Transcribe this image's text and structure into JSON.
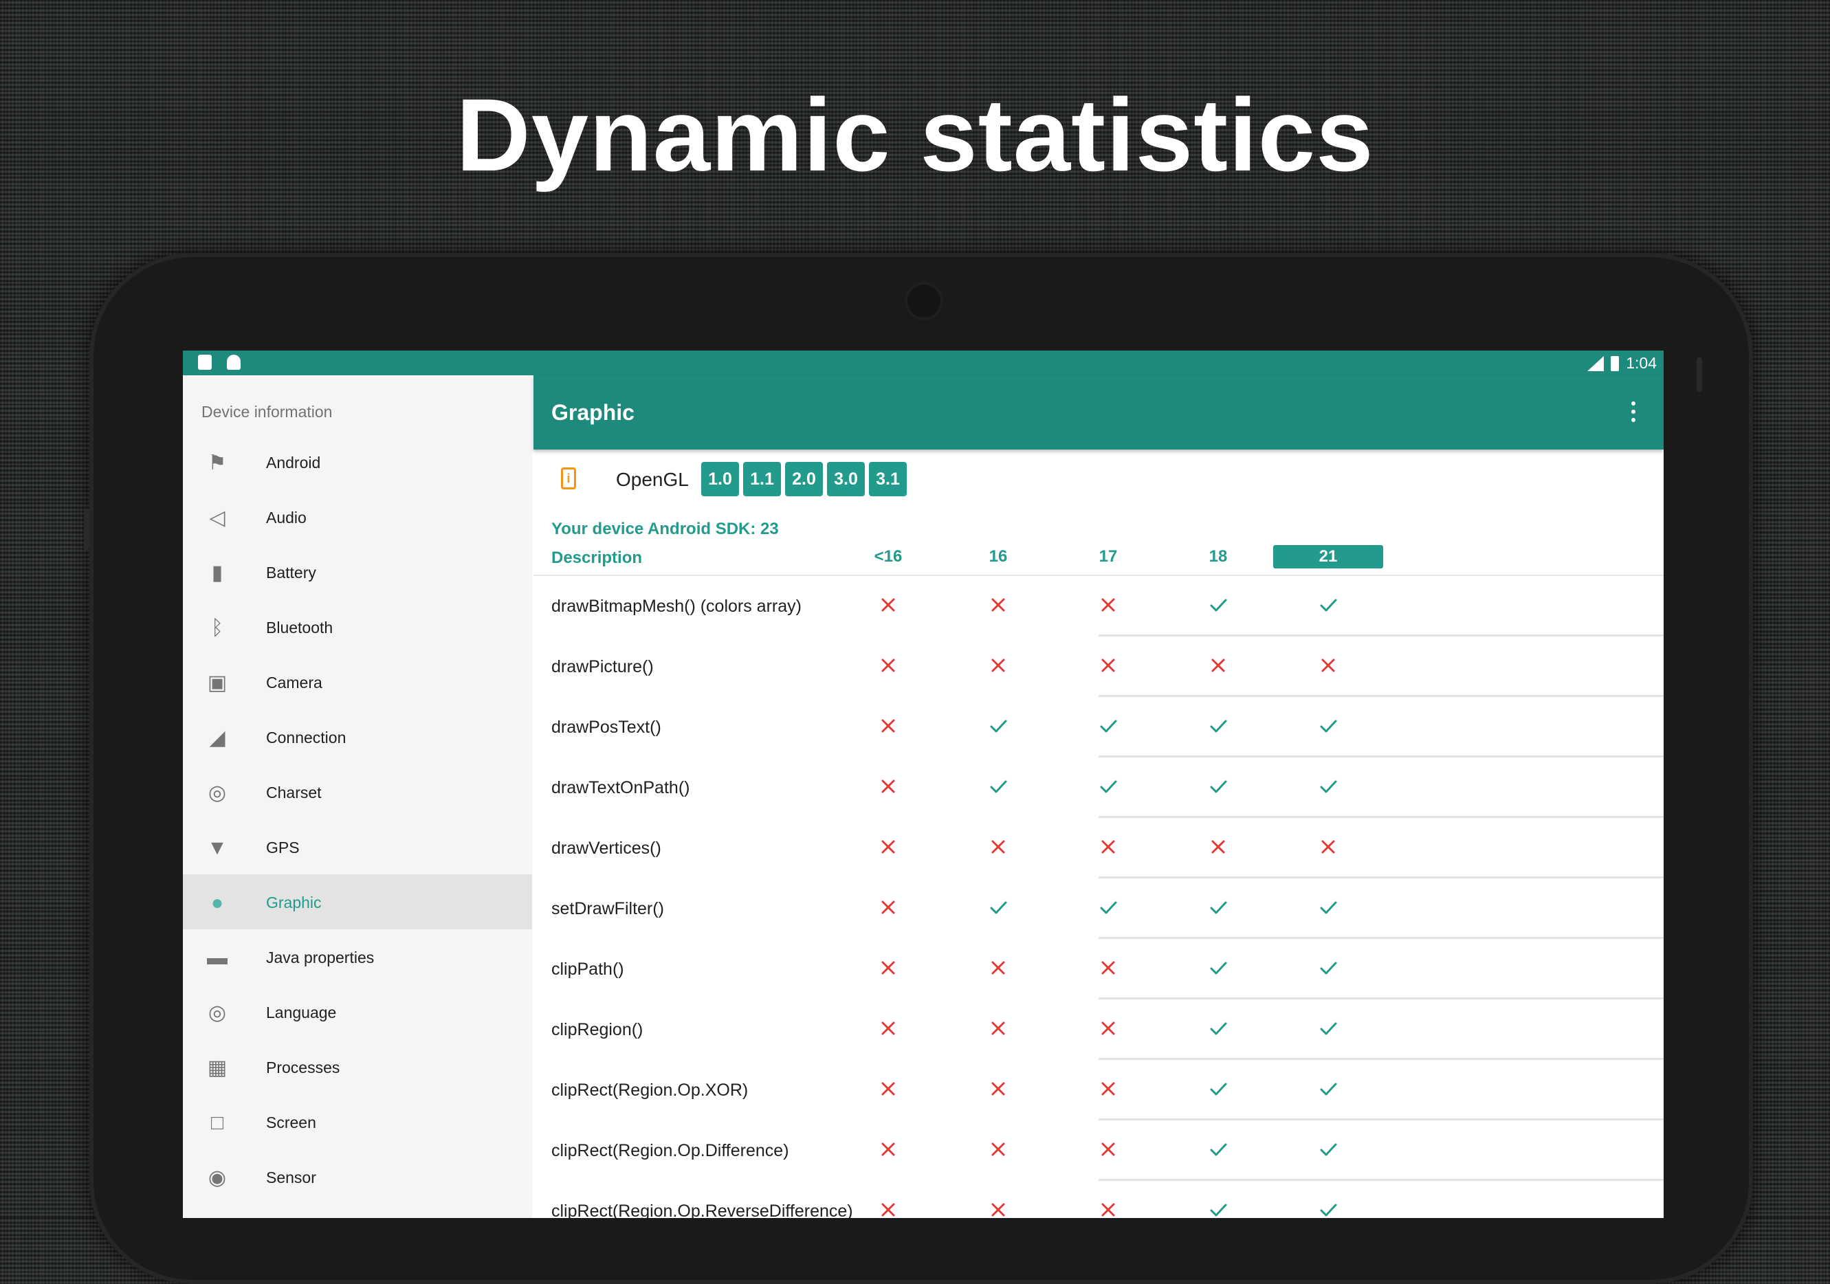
{
  "headline": "Dynamic statistics",
  "status_bar": {
    "time": "1:04",
    "network": "LTE"
  },
  "drawer": {
    "header": "Device information",
    "items": [
      {
        "label": "Android",
        "icon": "android-icon"
      },
      {
        "label": "Audio",
        "icon": "volume-icon"
      },
      {
        "label": "Battery",
        "icon": "battery-icon"
      },
      {
        "label": "Bluetooth",
        "icon": "bluetooth-icon"
      },
      {
        "label": "Camera",
        "icon": "camera-icon"
      },
      {
        "label": "Connection",
        "icon": "signal-settings-icon"
      },
      {
        "label": "Charset",
        "icon": "globe-icon"
      },
      {
        "label": "GPS",
        "icon": "location-pin-icon"
      },
      {
        "label": "Graphic",
        "icon": "palette-icon",
        "active": true
      },
      {
        "label": "Java properties",
        "icon": "coffee-cup-icon"
      },
      {
        "label": "Language",
        "icon": "globe-icon"
      },
      {
        "label": "Processes",
        "icon": "chip-icon"
      },
      {
        "label": "Screen",
        "icon": "screen-brightness-icon"
      },
      {
        "label": "Sensor",
        "icon": "sensor-icon"
      }
    ]
  },
  "appbar": {
    "title": "Graphic"
  },
  "opengl": {
    "label": "OpenGL",
    "versions": [
      "1.0",
      "1.1",
      "2.0",
      "3.0",
      "3.1"
    ]
  },
  "sdk_text": "Your device Android SDK: 23",
  "table": {
    "description_header": "Description",
    "versions": [
      "<16",
      "16",
      "17",
      "18",
      "21"
    ],
    "current_version": "21",
    "rows": [
      {
        "label": "drawBitmapMesh() (colors array)",
        "support": [
          false,
          false,
          false,
          true,
          true
        ]
      },
      {
        "label": "drawPicture()",
        "support": [
          false,
          false,
          false,
          false,
          false
        ]
      },
      {
        "label": "drawPosText()",
        "support": [
          false,
          true,
          true,
          true,
          true
        ]
      },
      {
        "label": "drawTextOnPath()",
        "support": [
          false,
          true,
          true,
          true,
          true
        ]
      },
      {
        "label": "drawVertices()",
        "support": [
          false,
          false,
          false,
          false,
          false
        ]
      },
      {
        "label": "setDrawFilter()",
        "support": [
          false,
          true,
          true,
          true,
          true
        ]
      },
      {
        "label": "clipPath()",
        "support": [
          false,
          false,
          false,
          true,
          true
        ]
      },
      {
        "label": "clipRegion()",
        "support": [
          false,
          false,
          false,
          true,
          true
        ]
      },
      {
        "label": "clipRect(Region.Op.XOR)",
        "support": [
          false,
          false,
          false,
          true,
          true
        ]
      },
      {
        "label": "clipRect(Region.Op.Difference)",
        "support": [
          false,
          false,
          false,
          true,
          true
        ]
      },
      {
        "label": "clipRect(Region.Op.ReverseDifference)",
        "support": [
          false,
          false,
          false,
          true,
          true
        ]
      }
    ]
  }
}
